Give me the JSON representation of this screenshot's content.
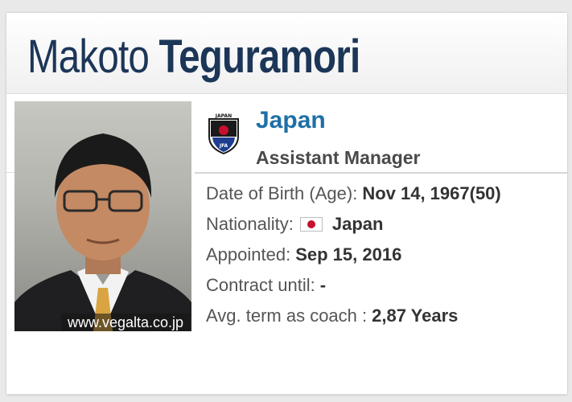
{
  "header": {
    "first_name": "Makoto",
    "last_name": "Teguramori"
  },
  "photo": {
    "credit": "www.vegalta.co.jp"
  },
  "team": {
    "crest_text": "JAPAN",
    "crest_letters": "JFA",
    "name": "Japan",
    "role": "Assistant Manager"
  },
  "details": {
    "dob_label": "Date of Birth (Age):",
    "dob_value": "Nov 14, 1967(50)",
    "nationality_label": "Nationality:",
    "nationality_value": "Japan",
    "appointed_label": "Appointed:",
    "appointed_value": "Sep 15, 2016",
    "contract_label": "Contract until:",
    "contract_value": "-",
    "term_label": "Avg. term as coach :",
    "term_value": "2,87 Years"
  },
  "colors": {
    "name_color": "#1c3658",
    "team_link": "#1e70a6",
    "flag_red": "#c8102e"
  },
  "icons": {
    "crest": "jfa-crest-icon",
    "flag": "japan-flag-icon"
  }
}
